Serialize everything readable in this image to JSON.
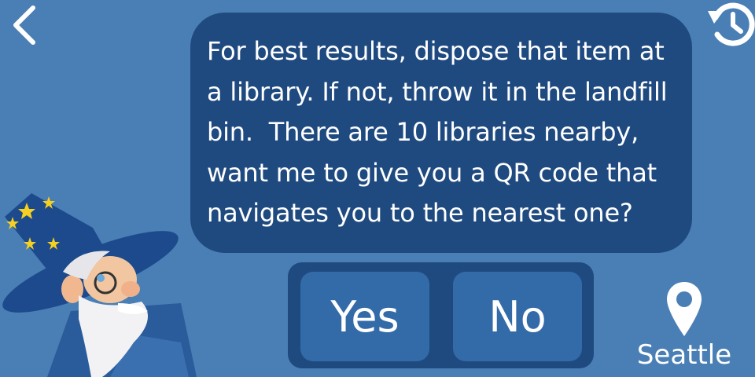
{
  "nav": {
    "back_icon": "chevron-left-icon",
    "history_icon": "history-icon"
  },
  "assistant": {
    "avatar": "wizard-avatar",
    "message": "For best results, dispose that item at\na library. If not, throw it in the landfill\nbin.  There are 10 libraries nearby,\nwant me to give you a QR code that\nnavigates you to the nearest one?"
  },
  "choices": {
    "yes_label": "Yes",
    "no_label": "No"
  },
  "location": {
    "icon": "location-pin-icon",
    "city": "Seattle"
  },
  "colors": {
    "background": "#4a7fb5",
    "bubble": "#1f4a80",
    "button": "#336aa8",
    "text": "#ffffff"
  }
}
